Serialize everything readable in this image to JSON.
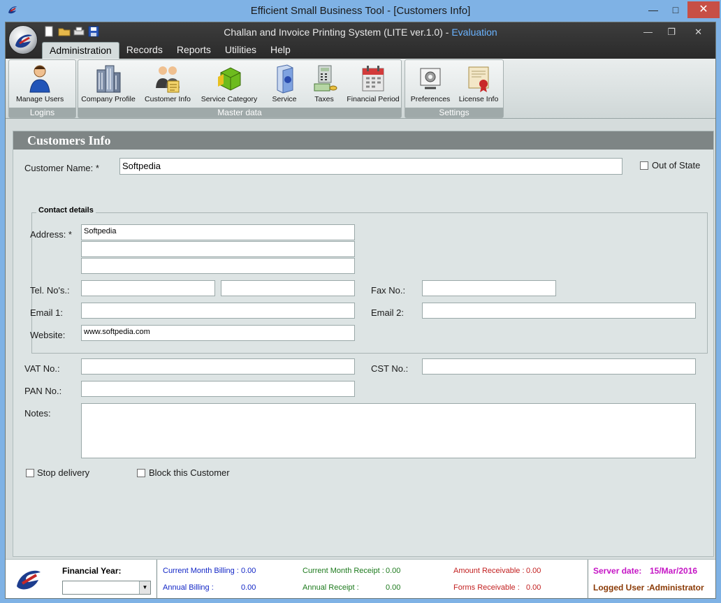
{
  "window": {
    "title": "Efficient Small Business Tool - [Customers Info]"
  },
  "app": {
    "title": "Challan and Invoice Printing System (LITE ver.1.0) - ",
    "edition": "Evaluation"
  },
  "menu": {
    "items": [
      {
        "label": "Administration"
      },
      {
        "label": "Records"
      },
      {
        "label": "Reports"
      },
      {
        "label": "Utilities"
      },
      {
        "label": "Help"
      }
    ]
  },
  "ribbon": {
    "groups": {
      "logins": {
        "label": "Logins",
        "buttons": [
          {
            "label": "Manage Users",
            "icon": "user-icon"
          }
        ]
      },
      "master": {
        "label": "Master data",
        "buttons": [
          {
            "label": "Company Profile",
            "icon": "building-icon"
          },
          {
            "label": "Customer Info",
            "icon": "customers-icon"
          },
          {
            "label": "Service Category",
            "icon": "cube-icon"
          },
          {
            "label": "Service",
            "icon": "box-icon"
          },
          {
            "label": "Taxes",
            "icon": "calculator-icon"
          },
          {
            "label": "Financial Period",
            "icon": "calendar-icon"
          }
        ]
      },
      "settings": {
        "label": "Settings",
        "buttons": [
          {
            "label": "Preferences",
            "icon": "preferences-icon"
          },
          {
            "label": "License Info",
            "icon": "certificate-icon"
          }
        ]
      }
    }
  },
  "form": {
    "header": "Customers Info",
    "customer_name_label": "Customer Name: *",
    "customer_name": "Softpedia",
    "out_of_state_label": "Out of State",
    "contact_legend": "Contact details",
    "address_label": "Address: *",
    "address_lines": [
      "Softpedia",
      "",
      ""
    ],
    "tel_label": "Tel. No's.:",
    "fax_label": "Fax No.:",
    "email1_label": "Email 1:",
    "email2_label": "Email 2:",
    "website_label": "Website:",
    "website": "www.softpedia.com",
    "vat_label": "VAT No.:",
    "cst_label": "CST No.:",
    "pan_label": "PAN No.:",
    "notes_label": "Notes:",
    "stop_delivery_label": "Stop delivery",
    "block_customer_label": "Block this Customer"
  },
  "status": {
    "financial_year_label": "Financial Year:",
    "current_month_billing_label": "Current Month Billing :",
    "current_month_billing": "0.00",
    "annual_billing_label": "Annual Billing :",
    "annual_billing": "0.00",
    "current_month_receipt_label": "Current Month Receipt :",
    "current_month_receipt": "0.00",
    "annual_receipt_label": "Annual Receipt :",
    "annual_receipt": "0.00",
    "amount_receivable_label": "Amount Receivable :",
    "amount_receivable": "0.00",
    "forms_receivable_label": "Forms Receivable :",
    "forms_receivable": "0.00",
    "server_date_label": "Server date:",
    "server_date": "15/Mar/2016",
    "logged_user_label": "Logged User :",
    "logged_user": "Administrator"
  },
  "colors": {
    "titlebar": "#7fb2e5",
    "ribbon_dark": "#2f2f2f",
    "evaluation": "#6ab3ff",
    "form_header": "#7e8585",
    "close_button": "#c74f45"
  }
}
